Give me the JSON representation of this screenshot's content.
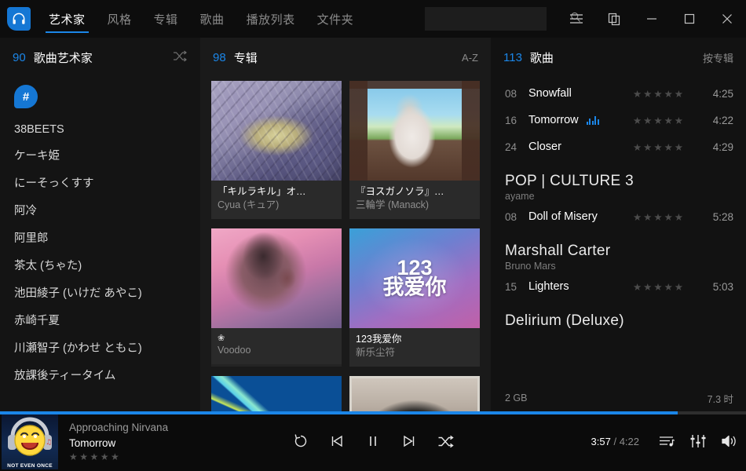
{
  "titlebar": {
    "logo_icon": "headphones-logo-icon",
    "tabs": [
      {
        "label": "艺术家",
        "active": true
      },
      {
        "label": "风格",
        "active": false
      },
      {
        "label": "专辑",
        "active": false
      },
      {
        "label": "歌曲",
        "active": false
      },
      {
        "label": "播放列表",
        "active": false
      },
      {
        "label": "文件夹",
        "active": false
      }
    ],
    "search": {
      "value": "",
      "placeholder": "",
      "icon": "search-icon"
    },
    "window_buttons": {
      "menu": "hamburger-menu-icon",
      "restore_layout": "duplicate-window-icon",
      "minimize": "minimize-icon",
      "maximize": "maximize-icon",
      "close": "close-icon"
    }
  },
  "sidebar": {
    "count": "90",
    "title": "歌曲艺术家",
    "shuffle_icon": "shuffle-icon",
    "letter_badge": "#",
    "items": [
      {
        "label": "38BEETS"
      },
      {
        "label": "ケーキ姫"
      },
      {
        "label": "にーそっくすす"
      },
      {
        "label": "阿冷"
      },
      {
        "label": "阿里郎"
      },
      {
        "label": "茶太 (ちゃた)"
      },
      {
        "label": "池田綾子 (いけだ あやこ)"
      },
      {
        "label": "赤崎千夏"
      },
      {
        "label": "川瀬智子 (かわせ ともこ)"
      },
      {
        "label": "放課後ティータイム"
      }
    ]
  },
  "albums": {
    "count": "98",
    "title": "专辑",
    "sort_label": "A-Z",
    "items": [
      {
        "name": "「キルラキル」オ…",
        "artist": "Cyua (キュア)",
        "art": "art-killlakill",
        "glyph": ""
      },
      {
        "name": "『ヨスガノソラ』…",
        "artist": "三輪学 (Manack)",
        "art": "art-yosuga",
        "glyph": ""
      },
      {
        "name": "",
        "artist": "Voodoo",
        "art": "art-voodoo",
        "glyph": "❀"
      },
      {
        "name": "123我爱你",
        "artist": "新乐尘符",
        "art": "art-loveyou",
        "glyph": ""
      },
      {
        "name": "",
        "artist": "",
        "art": "art-blue",
        "glyph": ""
      },
      {
        "name": "",
        "artist": "",
        "art": "art-photo",
        "glyph": ""
      }
    ]
  },
  "songs": {
    "count": "113",
    "title": "歌曲",
    "sort_label": "按专辑",
    "rows": [
      {
        "kind": "song",
        "num": "08",
        "title": "Snowfall",
        "stars": "★★★★★",
        "time": "4:25",
        "playing": false
      },
      {
        "kind": "song",
        "num": "16",
        "title": "Tomorrow",
        "stars": "★★★★★",
        "time": "4:22",
        "playing": true
      },
      {
        "kind": "song",
        "num": "24",
        "title": "Closer",
        "stars": "★★★★★",
        "time": "4:29",
        "playing": false
      },
      {
        "kind": "group",
        "title": "POP | CULTURE 3",
        "artist": "ayame"
      },
      {
        "kind": "song",
        "num": "08",
        "title": "Doll of Misery",
        "stars": "★★★★★",
        "time": "5:28",
        "playing": false
      },
      {
        "kind": "group",
        "title": "Marshall Carter",
        "artist": "Bruno Mars"
      },
      {
        "kind": "song",
        "num": "15",
        "title": "Lighters",
        "stars": "★★★★★",
        "time": "5:03",
        "playing": false
      },
      {
        "kind": "group",
        "title": "Delirium (Deluxe)",
        "artist": ""
      }
    ],
    "footer": {
      "size": "2 GB",
      "duration": "7.3 时"
    }
  },
  "player": {
    "now_playing": {
      "artist": "Approaching Nirvana",
      "title": "Tomorrow",
      "stars": "★★★★★",
      "art_caption": "NOT EVEN ONCE",
      "art_icon": "smiley-headphones-album-art"
    },
    "controls": {
      "repeat": "repeat-icon",
      "previous": "previous-track-icon",
      "playpause": "pause-icon",
      "next": "next-track-icon",
      "shuffle": "shuffle-icon"
    },
    "time_current": "3:57",
    "time_separator": "/",
    "time_total": "4:22",
    "progress_percent": 90.8,
    "right_controls": {
      "queue": "playlist-queue-icon",
      "equalizer": "equalizer-icon",
      "volume": "volume-icon"
    },
    "accent_color": "#1b86e8"
  }
}
